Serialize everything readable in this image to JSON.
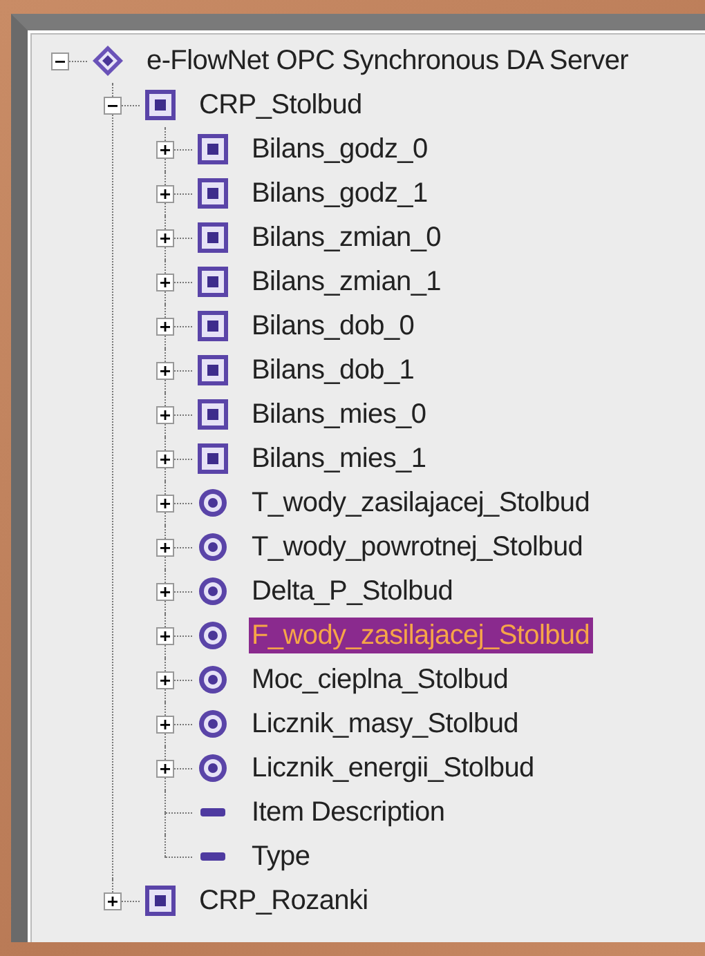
{
  "tree": [
    {
      "label": "e-FlowNet OPC Synchronous DA Server",
      "kind": "server",
      "expanded": true,
      "selected": false,
      "children": [
        {
          "label": "CRP_Stolbud",
          "kind": "folder",
          "expanded": true,
          "selected": false,
          "children": [
            {
              "label": "Bilans_godz_0",
              "kind": "folder",
              "expanded": false,
              "selected": false
            },
            {
              "label": "Bilans_godz_1",
              "kind": "folder",
              "expanded": false,
              "selected": false
            },
            {
              "label": "Bilans_zmian_0",
              "kind": "folder",
              "expanded": false,
              "selected": false
            },
            {
              "label": "Bilans_zmian_1",
              "kind": "folder",
              "expanded": false,
              "selected": false
            },
            {
              "label": "Bilans_dob_0",
              "kind": "folder",
              "expanded": false,
              "selected": false
            },
            {
              "label": "Bilans_dob_1",
              "kind": "folder",
              "expanded": false,
              "selected": false
            },
            {
              "label": "Bilans_mies_0",
              "kind": "folder",
              "expanded": false,
              "selected": false
            },
            {
              "label": "Bilans_mies_1",
              "kind": "folder",
              "expanded": false,
              "selected": false
            },
            {
              "label": "T_wody_zasilajacej_Stolbud",
              "kind": "tag",
              "expanded": false,
              "selected": false
            },
            {
              "label": "T_wody_powrotnej_Stolbud",
              "kind": "tag",
              "expanded": false,
              "selected": false
            },
            {
              "label": "Delta_P_Stolbud",
              "kind": "tag",
              "expanded": false,
              "selected": false
            },
            {
              "label": "F_wody_zasilajacej_Stolbud",
              "kind": "tag",
              "expanded": false,
              "selected": true
            },
            {
              "label": "Moc_cieplna_Stolbud",
              "kind": "tag",
              "expanded": false,
              "selected": false
            },
            {
              "label": "Licznik_masy_Stolbud",
              "kind": "tag",
              "expanded": false,
              "selected": false
            },
            {
              "label": "Licznik_energii_Stolbud",
              "kind": "tag",
              "expanded": false,
              "selected": false
            },
            {
              "label": "Item Description",
              "kind": "property",
              "selected": false
            },
            {
              "label": "Type",
              "kind": "property",
              "selected": false
            }
          ]
        },
        {
          "label": "CRP_Rozanki",
          "kind": "folder",
          "expanded": false,
          "selected": false
        }
      ]
    }
  ]
}
